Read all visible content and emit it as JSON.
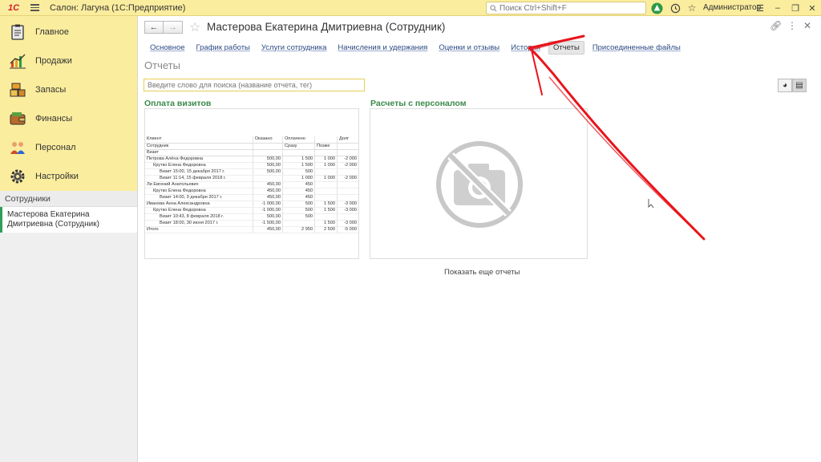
{
  "app": {
    "logo_text": "1С",
    "title": "Салон: Лагуна  (1С:Предприятие)",
    "search_placeholder": "Поиск Ctrl+Shift+F",
    "user": "Администратор"
  },
  "sidebar": {
    "sections": [
      {
        "label": "Главное",
        "icon": "clipboard-icon"
      },
      {
        "label": "Продажи",
        "icon": "bar-chart-icon"
      },
      {
        "label": "Запасы",
        "icon": "boxes-icon"
      },
      {
        "label": "Финансы",
        "icon": "wallet-icon"
      },
      {
        "label": "Персонал",
        "icon": "people-icon"
      },
      {
        "label": "Настройки",
        "icon": "gear-icon"
      }
    ],
    "open_header": "Сотрудники",
    "open_item": "Мастерова Екатерина Дмитриевна (Сотрудник)"
  },
  "header": {
    "title": "Мастерова Екатерина Дмитриевна (Сотрудник)"
  },
  "tabs": [
    {
      "label": "Основное",
      "active": false
    },
    {
      "label": "График работы",
      "active": false
    },
    {
      "label": "Услуги сотрудника",
      "active": false
    },
    {
      "label": "Начисления и удержания",
      "active": false
    },
    {
      "label": "Оценки и отзывы",
      "active": false
    },
    {
      "label": "История",
      "active": false
    },
    {
      "label": "Отчеты",
      "active": true
    },
    {
      "label": "Присоединенные файлы",
      "active": false
    }
  ],
  "reports_page": {
    "title": "Отчеты",
    "search_placeholder": "Введите слово для поиска (название отчета, тег)",
    "show_more": "Показать еще отчеты"
  },
  "report1": {
    "title": "Оплата визитов",
    "header": {
      "row1": [
        "Клиент",
        "Оказано",
        "Оплачено",
        "",
        "Долг"
      ],
      "row2": [
        "Сотрудник",
        "",
        "Сразу",
        "Позже",
        ""
      ],
      "row3": [
        "Визит",
        "",
        "",
        "",
        ""
      ]
    },
    "rows": [
      {
        "level": 0,
        "name": "Петрова Алёна Федоровна",
        "v1": "500,00",
        "v2": "1 500",
        "v3": "1 000",
        "v4": "-2 000"
      },
      {
        "level": 1,
        "name": "Крутко Елена Федоровна",
        "v1": "500,00",
        "v2": "1 500",
        "v3": "1 000",
        "v4": "-2 000"
      },
      {
        "level": 2,
        "name": "Визит 15:00, 15 декабря 2017 г.",
        "v1": "500,00",
        "v2": "500",
        "v3": "",
        "v4": ""
      },
      {
        "level": 2,
        "name": "Визит 11:14, 15 февраля 2018 г.",
        "v1": "",
        "v2": "1 000",
        "v3": "1 000",
        "v4": "-2 000"
      },
      {
        "level": 0,
        "name": "Ли Евгений Анатольевич",
        "v1": "450,00",
        "v2": "450",
        "v3": "",
        "v4": ""
      },
      {
        "level": 1,
        "name": "Крутко Елена Федоровна",
        "v1": "450,00",
        "v2": "450",
        "v3": "",
        "v4": ""
      },
      {
        "level": 2,
        "name": "Визит 14:00, 9 декабря 2017 г.",
        "v1": "450,00",
        "v2": "450",
        "v3": "",
        "v4": ""
      },
      {
        "level": 0,
        "name": "Иванова Анна Александровна",
        "v1": "-1 000,00",
        "v2": "500",
        "v3": "1 500",
        "v4": "-3 000"
      },
      {
        "level": 1,
        "name": "Крутко Елена Федоровна",
        "v1": "-1 000,00",
        "v2": "500",
        "v3": "1 500",
        "v4": "-3 000"
      },
      {
        "level": 2,
        "name": "Визит 10:43, 8 февраля 2018 г.",
        "v1": "500,00",
        "v2": "500",
        "v3": "",
        "v4": ""
      },
      {
        "level": 2,
        "name": "Визит 18:00, 30 июня 2017 г.",
        "v1": "-1 500,00",
        "v2": "",
        "v3": "1 500",
        "v4": "-3 000"
      }
    ],
    "total": {
      "name": "Итого",
      "v1": "450,00",
      "v2": "2 950",
      "v3": "2 500",
      "v4": "-5 000"
    }
  },
  "report2": {
    "title": "Расчеты с персоналом",
    "image_icon": "no-image-camera-icon"
  },
  "colors": {
    "accent_yellow": "#fbed9e",
    "green_title": "#3a8a4a",
    "link_blue": "#2b4a83",
    "annotation_red": "#e8141b"
  }
}
